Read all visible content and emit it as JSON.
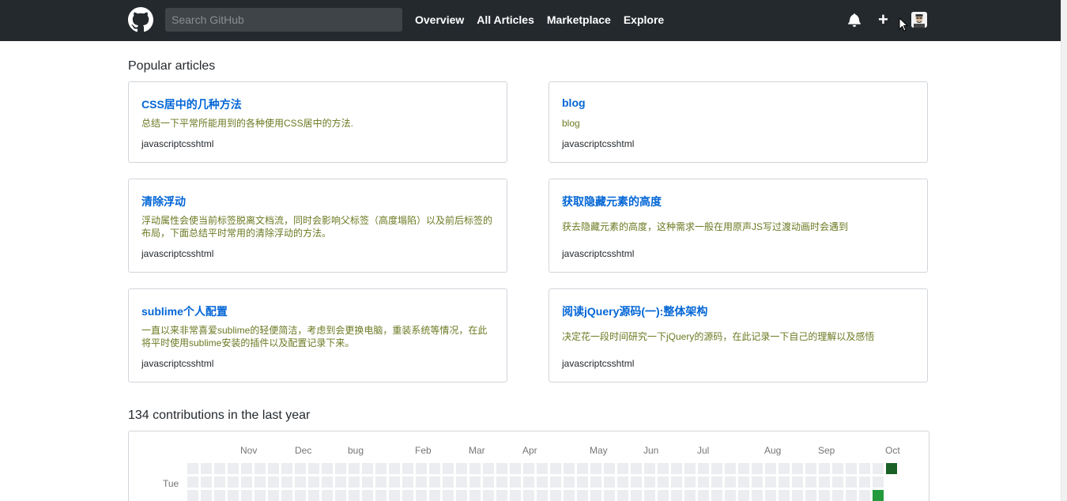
{
  "header": {
    "search_placeholder": "Search GitHub",
    "nav": [
      "Overview",
      "All Articles",
      "Marketplace",
      "Explore"
    ]
  },
  "popular": {
    "title": "Popular articles",
    "cards": [
      {
        "title": "CSS居中的几种方法",
        "desc": "总结一下平常所能用到的各种使用CSS居中的方法.",
        "tags": "javascriptcsshtml"
      },
      {
        "title": "blog",
        "desc": "blog",
        "tags": "javascriptcsshtml"
      },
      {
        "title": "清除浮动",
        "desc": "浮动属性会使当前标签脱离文档流，同时会影响父标签（高度塌陷）以及前后标签的布局，下面总结平时常用的清除浮动的方法。",
        "tags": "javascriptcsshtml"
      },
      {
        "title": "获取隐藏元素的高度",
        "desc": "获去隐藏元素的高度，这种需求一般在用原声JS写过渡动画时会遇到",
        "tags": "javascriptcsshtml"
      },
      {
        "title": "sublime个人配置",
        "desc": "一直以来非常喜爱sublime的轻便简洁，考虑到会更换电脑，重装系统等情况，在此将平时使用sublime安装的插件以及配置记录下来。",
        "tags": "javascriptcsshtml"
      },
      {
        "title": "阅读jQuery源码(一):整体架构",
        "desc": "决定花一段时间研究一下jQuery的源码，在此记录一下自己的理解以及感悟",
        "tags": "javascriptcsshtml"
      }
    ]
  },
  "contributions": {
    "title": "134 contributions in the last year",
    "months": [
      "Nov",
      "Dec",
      "bug",
      "Feb",
      "Mar",
      "Apr",
      "May",
      "Jun",
      "Jul",
      "Aug",
      "Sep",
      "Oct"
    ],
    "day_label": "Tue",
    "colors": {
      "empty": "#ebedf0",
      "level2": "#239a3b",
      "level4": "#196127"
    }
  }
}
